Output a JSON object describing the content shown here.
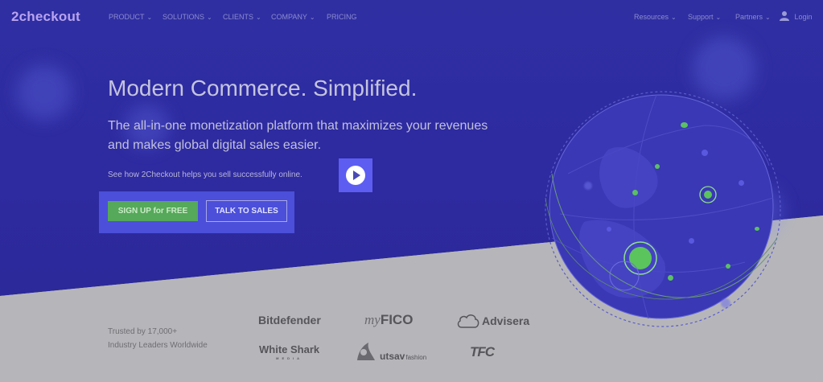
{
  "header": {
    "logo": {
      "left": "2check",
      "right": "out"
    },
    "nav": [
      "PRODUCT",
      "SOLUTIONS",
      "CLIENTS",
      "COMPANY",
      "PRICING"
    ],
    "right_nav": [
      "Resources",
      "Support",
      "Partners"
    ],
    "login": "Login"
  },
  "hero": {
    "title": "Modern Commerce. Simplified.",
    "subtitle": "The all-in-one monetization platform that maximizes your revenues and makes global digital sales easier.",
    "video_prompt": "See how 2Checkout helps you sell successfully online.",
    "signup_label": "SIGN UP for FREE",
    "talk_label": "TALK TO SALES"
  },
  "trusted": {
    "line1": "Trusted by 17,000+",
    "line2": "Industry Leaders Worldwide"
  },
  "brands": {
    "bitdefender": "Bitdefender",
    "myfico_my": "my",
    "myfico_fico": "FICO",
    "advisera": "Advisera",
    "whiteshark": "White Shark",
    "whiteshark_sub": "MEDIA",
    "utsav": "utsav",
    "utsav_sub": "fashion",
    "tfc": "TFC"
  },
  "colors": {
    "hero_bg": "#2f2fa2",
    "signup": "#56a85a",
    "play": "#5d5df2"
  },
  "icons": {
    "play": "play-icon",
    "user": "user-icon",
    "globe": "globe-graphic"
  }
}
